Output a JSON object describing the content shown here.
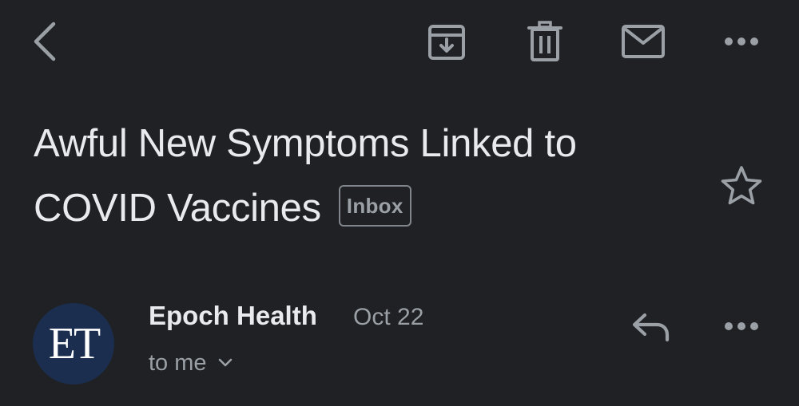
{
  "toolbar": {
    "back_icon": "arrow-left-icon",
    "archive_icon": "archive-icon",
    "delete_icon": "trash-icon",
    "mark_unread_icon": "mail-icon",
    "more_icon": "more-horizontal-icon"
  },
  "message": {
    "subject": "Awful New Symptoms Linked to COVID Vaccines",
    "label": "Inbox",
    "starred": false
  },
  "sender": {
    "avatar_text": "ET",
    "name": "Epoch Health",
    "date": "Oct 22",
    "recipient": "to me"
  },
  "colors": {
    "background": "#202124",
    "text_primary": "#e8eaed",
    "text_secondary": "#9aa0a6",
    "avatar_bg": "#1b2e4f"
  }
}
